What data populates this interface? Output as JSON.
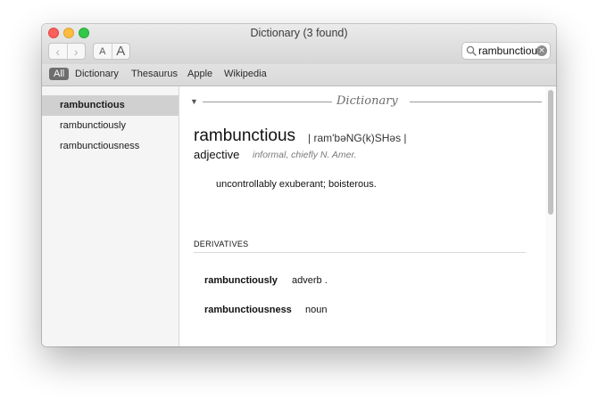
{
  "window": {
    "title": "Dictionary (3 found)"
  },
  "toolbar": {
    "back_label": "‹",
    "forward_label": "›",
    "font_smaller_label": "A",
    "font_larger_label": "A"
  },
  "search": {
    "value": "rambunctious",
    "clear_glyph": "×"
  },
  "scope_tabs": [
    {
      "label": "All",
      "active": true
    },
    {
      "label": "Dictionary",
      "active": false
    },
    {
      "label": "Thesaurus",
      "active": false
    },
    {
      "label": "Apple",
      "active": false
    },
    {
      "label": "Wikipedia",
      "active": false
    }
  ],
  "sidebar": {
    "items": [
      {
        "label": "rambunctious",
        "selected": true
      },
      {
        "label": "rambunctiously",
        "selected": false
      },
      {
        "label": "rambunctiousness",
        "selected": false
      }
    ]
  },
  "entry": {
    "section_title": "Dictionary",
    "headword": "rambunctious",
    "pronunciation": "| ram'bəNG(k)SHəs |",
    "part_of_speech": "adjective",
    "register": "informal, chiefly N. Amer.",
    "definition": "uncontrollably exuberant; boisterous.",
    "derivatives_heading": "DERIVATIVES",
    "derivatives": [
      {
        "word": "rambunctiously",
        "pos": "adverb ."
      },
      {
        "word": "rambunctiousness",
        "pos": "noun"
      }
    ]
  },
  "colors": {
    "close": "#fc605c",
    "minimize": "#fdbc40",
    "maximize": "#34c84a",
    "scope_active": "#6e6e6e",
    "sidebar_selected": "#d0d0d0"
  }
}
